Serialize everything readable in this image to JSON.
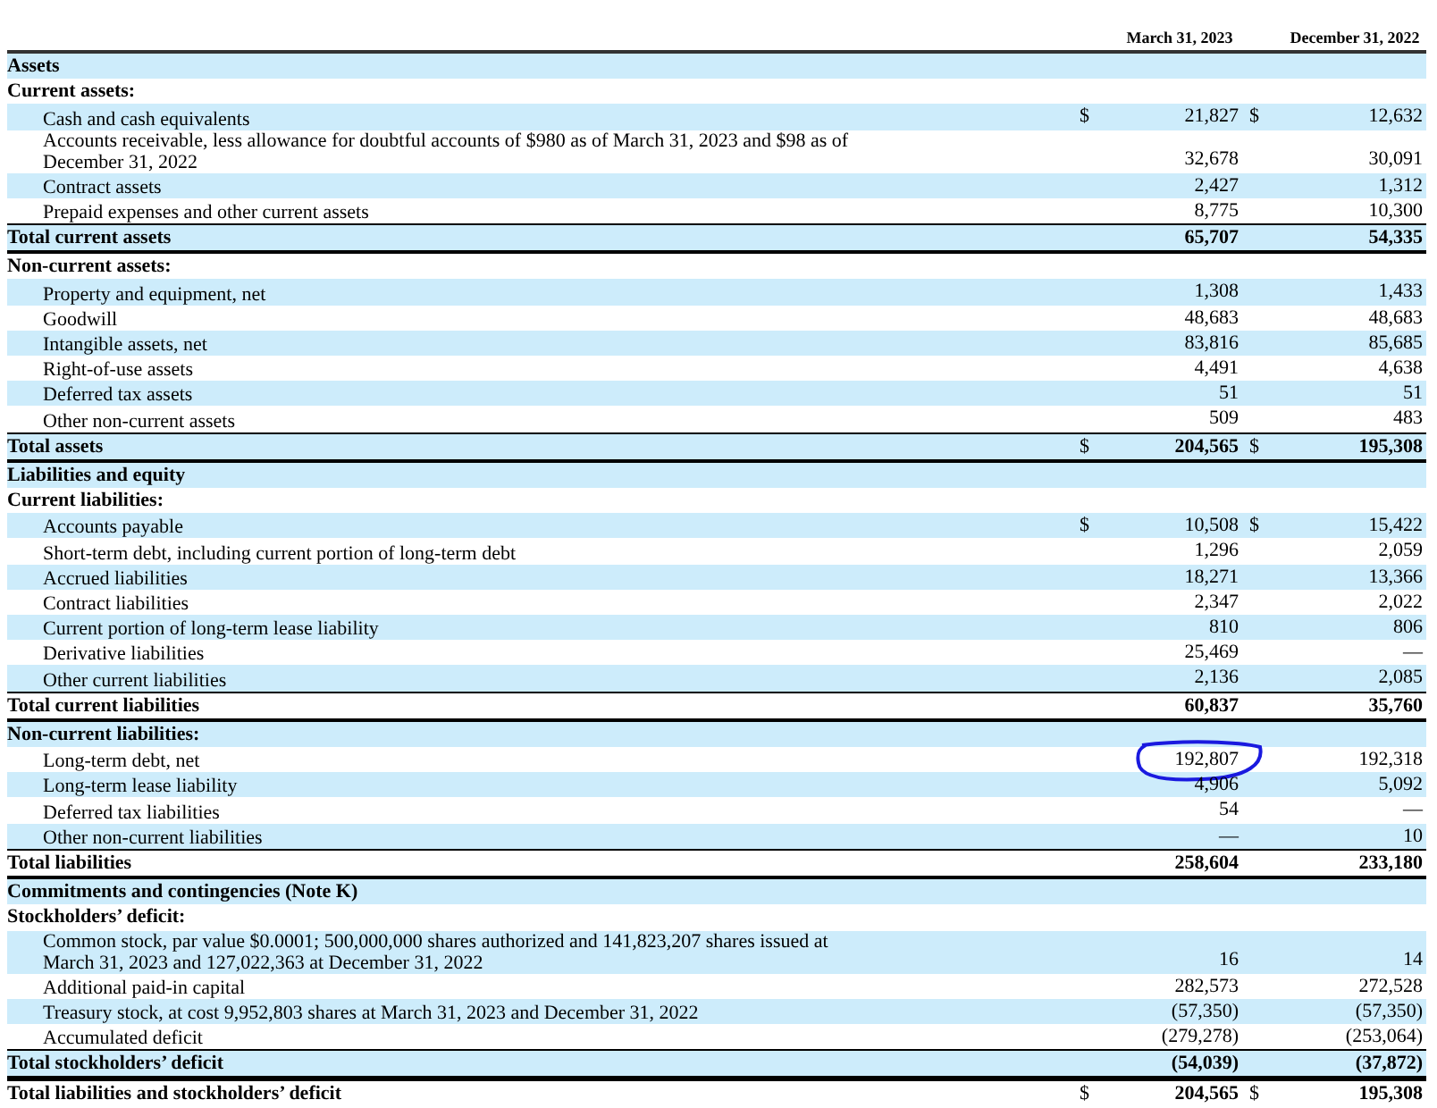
{
  "columns": [
    "March 31, 2023",
    "December 31, 2022"
  ],
  "rows": [
    {
      "kind": "section",
      "shaded": true,
      "label": "Assets"
    },
    {
      "kind": "section",
      "shaded": false,
      "label": "Current assets:"
    },
    {
      "kind": "item",
      "shaded": true,
      "label": "Cash and cash equivalents",
      "currency_1": "$",
      "value_1": "21,827",
      "currency_2": "$",
      "value_2": "12,632"
    },
    {
      "kind": "item",
      "shaded": false,
      "label": "Accounts receivable, less allowance for doubtful accounts of $980 as of March 31, 2023 and $98 as of December 31, 2022",
      "value_1": "32,678",
      "value_2": "30,091"
    },
    {
      "kind": "item",
      "shaded": true,
      "label": "Contract assets",
      "value_1": "2,427",
      "value_2": "1,312"
    },
    {
      "kind": "item",
      "shaded": false,
      "label": "Prepaid expenses and other current assets",
      "value_1": "8,775",
      "value_2": "10,300"
    },
    {
      "kind": "total",
      "shaded": true,
      "label": "Total current assets",
      "value_1": "65,707",
      "value_2": "54,335"
    },
    {
      "kind": "section",
      "shaded": false,
      "label": "Non-current assets:"
    },
    {
      "kind": "item",
      "shaded": true,
      "label": "Property and equipment, net",
      "value_1": "1,308",
      "value_2": "1,433"
    },
    {
      "kind": "item",
      "shaded": false,
      "label": "Goodwill",
      "value_1": "48,683",
      "value_2": "48,683"
    },
    {
      "kind": "item",
      "shaded": true,
      "label": "Intangible assets, net",
      "value_1": "83,816",
      "value_2": "85,685"
    },
    {
      "kind": "item",
      "shaded": false,
      "label": "Right-of-use assets",
      "value_1": "4,491",
      "value_2": "4,638"
    },
    {
      "kind": "item",
      "shaded": true,
      "label": "Deferred tax assets",
      "value_1": "51",
      "value_2": "51"
    },
    {
      "kind": "item",
      "shaded": false,
      "label": "Other non-current assets",
      "value_1": "509",
      "value_2": "483"
    },
    {
      "kind": "total",
      "shaded": true,
      "label": "Total assets",
      "currency_1": "$",
      "value_1": "204,565",
      "currency_2": "$",
      "value_2": "195,308"
    },
    {
      "kind": "section",
      "shaded": true,
      "label": "Liabilities and equity"
    },
    {
      "kind": "section",
      "shaded": false,
      "label": "Current liabilities:"
    },
    {
      "kind": "item",
      "shaded": true,
      "label": "Accounts payable",
      "currency_1": "$",
      "value_1": "10,508",
      "currency_2": "$",
      "value_2": "15,422"
    },
    {
      "kind": "item",
      "shaded": false,
      "label": "Short-term debt, including current portion of long-term debt",
      "value_1": "1,296",
      "value_2": "2,059"
    },
    {
      "kind": "item",
      "shaded": true,
      "label": "Accrued liabilities",
      "value_1": "18,271",
      "value_2": "13,366"
    },
    {
      "kind": "item",
      "shaded": false,
      "label": "Contract liabilities",
      "value_1": "2,347",
      "value_2": "2,022"
    },
    {
      "kind": "item",
      "shaded": true,
      "label": "Current portion of long-term lease liability",
      "value_1": "810",
      "value_2": "806"
    },
    {
      "kind": "item",
      "shaded": false,
      "label": "Derivative liabilities",
      "value_1": "25,469",
      "value_2": "—"
    },
    {
      "kind": "item",
      "shaded": true,
      "label": "Other current liabilities",
      "value_1": "2,136",
      "value_2": "2,085"
    },
    {
      "kind": "total",
      "shaded": false,
      "label": "Total current liabilities",
      "value_1": "60,837",
      "value_2": "35,760"
    },
    {
      "kind": "section",
      "shaded": true,
      "label": "Non-current liabilities:"
    },
    {
      "kind": "item",
      "shaded": false,
      "circled": true,
      "label": "Long-term debt, net",
      "value_1": "192,807",
      "value_2": "192,318"
    },
    {
      "kind": "item",
      "shaded": true,
      "label": "Long-term lease liability",
      "value_1": "4,906",
      "value_2": "5,092"
    },
    {
      "kind": "item",
      "shaded": false,
      "label": "Deferred tax liabilities",
      "value_1": "54",
      "value_2": "—"
    },
    {
      "kind": "item",
      "shaded": true,
      "label": "Other non-current liabilities",
      "value_1": "—",
      "value_2": "10"
    },
    {
      "kind": "total",
      "shaded": false,
      "label": "Total liabilities",
      "value_1": "258,604",
      "value_2": "233,180"
    },
    {
      "kind": "section",
      "shaded": true,
      "label": "Commitments and contingencies (Note K)"
    },
    {
      "kind": "section",
      "shaded": false,
      "label": "Stockholders’ deficit:"
    },
    {
      "kind": "item",
      "shaded": true,
      "label": "Common stock, par value $0.0001; 500,000,000 shares authorized and 141,823,207 shares issued at March 31, 2023 and 127,022,363 at December 31, 2022",
      "value_1": "16",
      "value_2": "14"
    },
    {
      "kind": "item",
      "shaded": false,
      "label": "Additional paid-in capital",
      "value_1": "282,573",
      "value_2": "272,528"
    },
    {
      "kind": "item",
      "shaded": true,
      "label": "Treasury stock, at cost 9,952,803 shares at March 31, 2023 and December 31, 2022",
      "value_1": "(57,350)",
      "value_2": "(57,350)"
    },
    {
      "kind": "item",
      "shaded": false,
      "label": "Accumulated deficit",
      "value_1": "(279,278)",
      "value_2": "(253,064)"
    },
    {
      "kind": "total",
      "shaded": true,
      "label": "Total stockholders’ deficit",
      "value_1": "(54,039)",
      "value_2": "(37,872)"
    },
    {
      "kind": "total",
      "shaded": false,
      "label": "Total liabilities and stockholders’ deficit",
      "currency_1": "$",
      "value_1": "204,565",
      "currency_2": "$",
      "value_2": "195,308"
    }
  ]
}
